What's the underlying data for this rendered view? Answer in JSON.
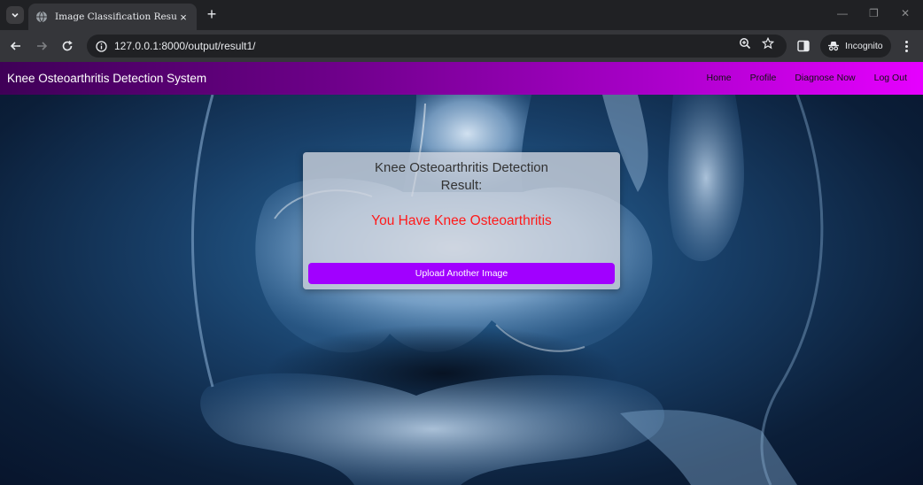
{
  "browser": {
    "tab_title": "Image Classification Result",
    "tab_close": "×",
    "new_tab": "+",
    "url": "127.0.0.1:8000/output/result1/",
    "incognito_label": "Incognito",
    "minimize": "—",
    "maximize": "❐",
    "close": "✕"
  },
  "navbar": {
    "brand": "Knee Osteoarthritis Detection System",
    "links": [
      "Home",
      "Profile",
      "Diagnose Now",
      "Log Out"
    ]
  },
  "card": {
    "title_line1": "Knee Osteoarthritis Detection",
    "title_line2": "Result:",
    "result_text": "You Have Knee Osteoarthritis",
    "button_label": "Upload Another Image"
  },
  "colors": {
    "result_text": "#ff1a1a",
    "button": "#a100ff",
    "navbar_start": "#3f0057",
    "navbar_end": "#e600ff"
  }
}
